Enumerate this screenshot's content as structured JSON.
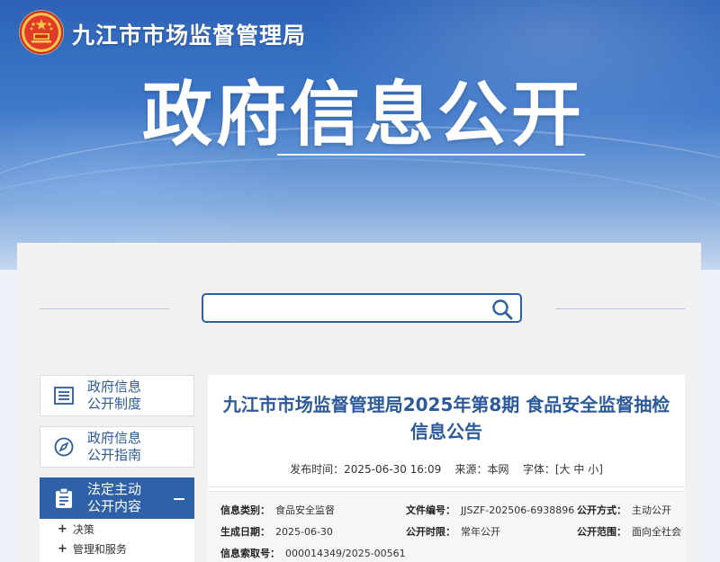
{
  "header": {
    "site_title": "九江市市场监督管理局",
    "banner_title": "政府信息公开",
    "emblem_icon": "national-emblem-icon"
  },
  "search": {
    "placeholder": "",
    "value": "",
    "icon": "search-icon"
  },
  "sidebar": {
    "items": [
      {
        "label_line1": "政府信息",
        "label_line2": "公开制度",
        "icon": "document-list-icon",
        "active": false
      },
      {
        "label_line1": "政府信息",
        "label_line2": "公开指南",
        "icon": "compass-icon",
        "active": false
      },
      {
        "label_line1": "法定主动",
        "label_line2": "公开内容",
        "icon": "clipboard-icon",
        "active": true
      }
    ],
    "sub_items": [
      {
        "label": "决策"
      },
      {
        "label": "管理和服务"
      }
    ]
  },
  "article": {
    "title": "九江市市场监督管理局2025年第8期 食品安全监督抽检信息公告",
    "publish_label": "发布时间：",
    "publish_time": "2025-06-30 16:09",
    "source_label": "来源：",
    "source": "本网",
    "fontsize_label": "字体：",
    "fontsize_open": "[",
    "fontsize_large": "大",
    "fontsize_medium": "中",
    "fontsize_small": "小",
    "fontsize_close": "]",
    "info": {
      "category_label": "信息类别：",
      "category": "食品安全监督",
      "docno_label": "文件编号：",
      "docno": "JJSZF-202506-6938896",
      "method_label": "公开方式：",
      "method": "主动公开",
      "date_label": "生成日期：",
      "date": "2025-06-30",
      "period_label": "公开时限：",
      "period": "常年公开",
      "scope_label": "公开范围：",
      "scope": "面向全社会",
      "index_label": "信息索取号：",
      "index": "000014349/2025-00561"
    }
  },
  "colors": {
    "primary_blue": "#2f61a8",
    "title_blue": "#2d5a99",
    "banner_blue": "#2c63b8",
    "panel_bg": "#f1f1f1"
  }
}
